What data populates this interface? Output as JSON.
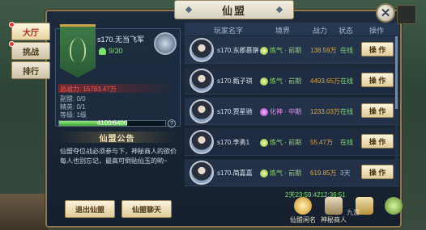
{
  "window": {
    "title": "仙盟"
  },
  "tabs": [
    {
      "label": "大厅",
      "active": true,
      "badge": true
    },
    {
      "label": "挑战",
      "active": false,
      "badge": true
    },
    {
      "label": "排行",
      "active": false,
      "badge": false
    }
  ],
  "guild": {
    "name": "s170.无当飞军",
    "members": "9/30",
    "total_power": "总战力: 15783.47万",
    "vice_leader": "副盟: 0/0",
    "elite": "精英: 0/1",
    "level": "等级: 1级",
    "level_progress": "4100/6400",
    "level_fraction": 0.64,
    "info_glyph": "?"
  },
  "notice": {
    "title": "仙盟公告",
    "text": "仙盟夺位战必须参与下，神秘商人的欲价每人也别忘记，最高可倒贴仙玉的哟~"
  },
  "buttons": {
    "leave": "退出仙盟",
    "chat": "仙盟聊天"
  },
  "table": {
    "headers": {
      "name": "玩家名字",
      "realm": "境界",
      "power": "战力",
      "status": "状态",
      "op": "操作"
    },
    "rows": [
      {
        "name": "s170.东郡慕翀",
        "realm": "炼气 · 前期",
        "realm_tier": "green",
        "power": "138.59万",
        "status": "在线",
        "online": true,
        "op": "操 作"
      },
      {
        "name": "s170.甄子琪",
        "realm": "炼气 · 前期",
        "realm_tier": "green",
        "power": "4493.65万",
        "status": "在线",
        "online": true,
        "op": "操 作"
      },
      {
        "name": "s170.贾星驰",
        "realm": "化神 · 中期",
        "realm_tier": "purple",
        "power": "1233.03万",
        "status": "在线",
        "online": true,
        "op": "操 作"
      },
      {
        "name": "s170.李勇1",
        "realm": "炼气 · 前期",
        "realm_tier": "green",
        "power": "55.47万",
        "status": "在线",
        "online": true,
        "op": "操 作"
      },
      {
        "name": "s170.简嘉嘉",
        "realm": "炼气 · 前期",
        "realm_tier": "green",
        "power": "619.85万",
        "status": "3天",
        "online": false,
        "op": "操 作"
      }
    ]
  },
  "timer": "2天23:59:4212:36:51",
  "bottom_bar": [
    {
      "label": "仙盟闲名",
      "icon": "god"
    },
    {
      "label": "神秘商人",
      "icon": "shop"
    },
    {
      "label": "",
      "icon": "scroll"
    },
    {
      "label": "",
      "icon": "plant"
    }
  ],
  "close_glyph": "✕",
  "watermark": "九游"
}
